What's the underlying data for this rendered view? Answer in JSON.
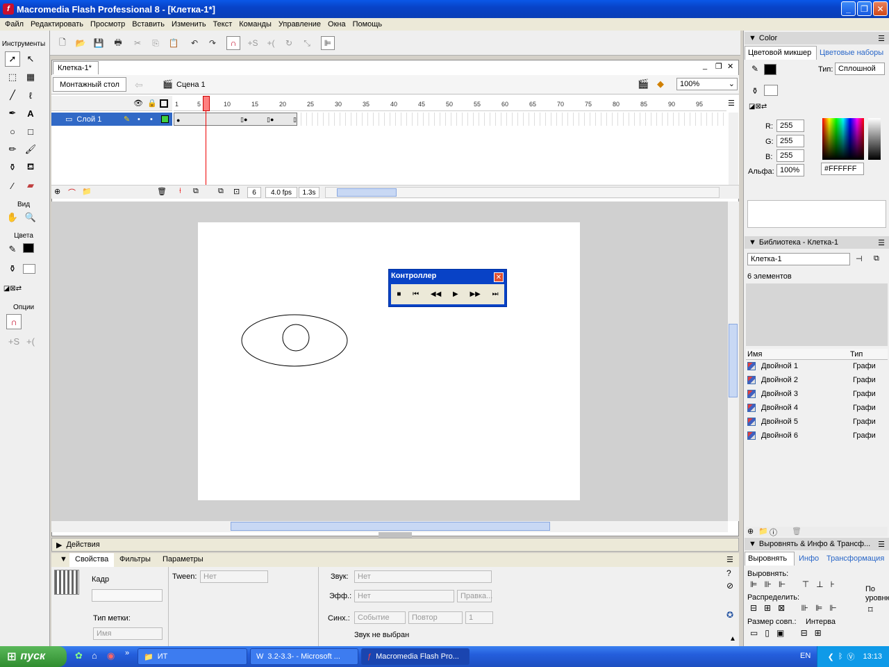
{
  "window": {
    "title": "Macromedia Flash Professional 8 - [Клетка-1*]"
  },
  "menu": [
    "Файл",
    "Редактировать",
    "Просмотр",
    "Вставить",
    "Изменить",
    "Текст",
    "Команды",
    "Управление",
    "Окна",
    "Помощь"
  ],
  "tools": {
    "title": "Инструменты",
    "view_label": "Вид",
    "colors_label": "Цвета",
    "options_label": "Опции"
  },
  "document": {
    "tab": "Клетка-1*",
    "stage_button": "Монтажный стол",
    "scene": "Сцена 1",
    "zoom": "100%",
    "layer_name": "Слой 1",
    "ruler_ticks": [
      "1",
      "5",
      "10",
      "15",
      "20",
      "25",
      "30",
      "35",
      "40",
      "45",
      "50",
      "55",
      "60",
      "65",
      "70",
      "75",
      "80",
      "85",
      "90",
      "95"
    ],
    "current_frame": "6",
    "fps": "4.0 fps",
    "elapsed": "1.3s"
  },
  "controller": {
    "title": "Контроллер"
  },
  "actions": {
    "label": "Действия"
  },
  "properties": {
    "tabs": [
      "Свойства",
      "Фильтры",
      "Параметры"
    ],
    "frame_label": "Кадр",
    "tween_label": "Tween:",
    "tween_value": "Нет",
    "sound_label": "Звук:",
    "sound_value": "Нет",
    "effect_label": "Эфф.:",
    "effect_value": "Нет",
    "edit_button": "Правка...",
    "sync_label": "Синх.:",
    "sync_value": "Событие",
    "repeat_value": "Повтор",
    "repeat_count": "1",
    "no_sound": "Звук не выбран",
    "label_type": "Тип метки:",
    "name_placeholder": "Имя"
  },
  "color_panel": {
    "title": "Color",
    "tabs": [
      "Цветовой микшер",
      "Цветовые наборы"
    ],
    "type_label": "Тип:",
    "type_value": "Сплошной",
    "r_label": "R:",
    "r": "255",
    "g_label": "G:",
    "g": "255",
    "b_label": "B:",
    "b": "255",
    "alpha_label": "Альфа:",
    "alpha": "100%",
    "hex": "#FFFFFF"
  },
  "library": {
    "title": "Библиотека - Клетка-1",
    "doc_select": "Клетка-1",
    "count": "6 элементов",
    "col_name": "Имя",
    "col_type": "Тип",
    "items": [
      {
        "name": "Двойной 1",
        "type": "Графи"
      },
      {
        "name": "Двойной 2",
        "type": "Графи"
      },
      {
        "name": "Двойной 3",
        "type": "Графи"
      },
      {
        "name": "Двойной 4",
        "type": "Графи"
      },
      {
        "name": "Двойной 5",
        "type": "Графи"
      },
      {
        "name": "Двойной 6",
        "type": "Графи"
      }
    ]
  },
  "align_panel": {
    "title": "Выровнять & Инфо & Трансф...",
    "tabs": [
      "Выровнять",
      "Инфо",
      "Трансформация"
    ],
    "align_label": "Выровнять:",
    "distribute_label": "Распределить:",
    "match_label": "Размер совп.:",
    "space_label": "Интерва",
    "to_stage_1": "По",
    "to_stage_2": "уровню"
  },
  "taskbar": {
    "start": "пуск",
    "tasks": [
      "ИТ",
      "3.2-3.3- - Microsoft ...",
      "Macromedia Flash Pro..."
    ],
    "lang": "EN",
    "time": "13:13"
  }
}
